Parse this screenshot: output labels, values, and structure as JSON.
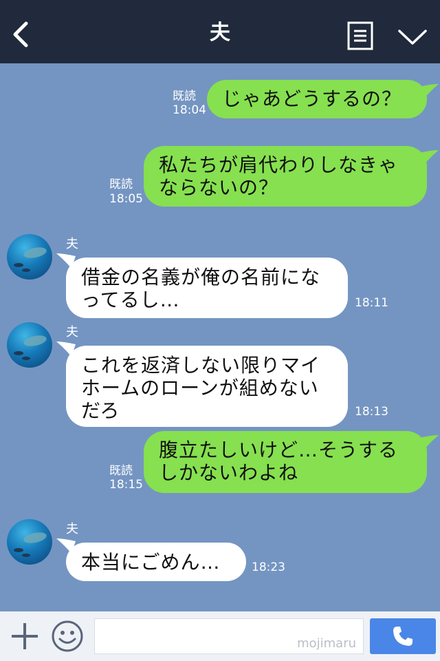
{
  "header": {
    "title": "夫"
  },
  "messages": {
    "m1": {
      "text": "じゃあどうするの？",
      "read": "既読",
      "time": "18:04"
    },
    "m2": {
      "line1": "私たちが肩代わりしなきゃ",
      "line2": "ならないの？",
      "read": "既読",
      "time": "18:05"
    },
    "m3": {
      "sender": "夫",
      "line1": "借金の名義が俺の名前にな",
      "line2": "ってるし…",
      "time": "18:11"
    },
    "m4": {
      "sender": "夫",
      "line1": "これを返済しない限りマイ",
      "line2": "ホームのローンが組めない",
      "line3": "だろ",
      "time": "18:13"
    },
    "m5": {
      "line1": "腹立たしいけど…そうする",
      "line2": "しかないわよね",
      "read": "既読",
      "time": "18:15"
    },
    "m6": {
      "sender": "夫",
      "text": "本当にごめん…",
      "time": "18:23"
    }
  },
  "input": {
    "watermark": "mojimaru",
    "placeholder": ""
  },
  "icons": {
    "back": "back-chevron-icon",
    "menu": "menu-list-icon",
    "collapse": "chevron-down-icon",
    "plus": "plus-icon",
    "emoji": "smiley-icon",
    "call": "phone-icon"
  },
  "colors": {
    "header_bg": "#202a3c",
    "chat_bg": "#7495c2",
    "outgoing_bubble": "#86e04f",
    "incoming_bubble": "#ffffff",
    "call_button": "#4a86e8"
  }
}
